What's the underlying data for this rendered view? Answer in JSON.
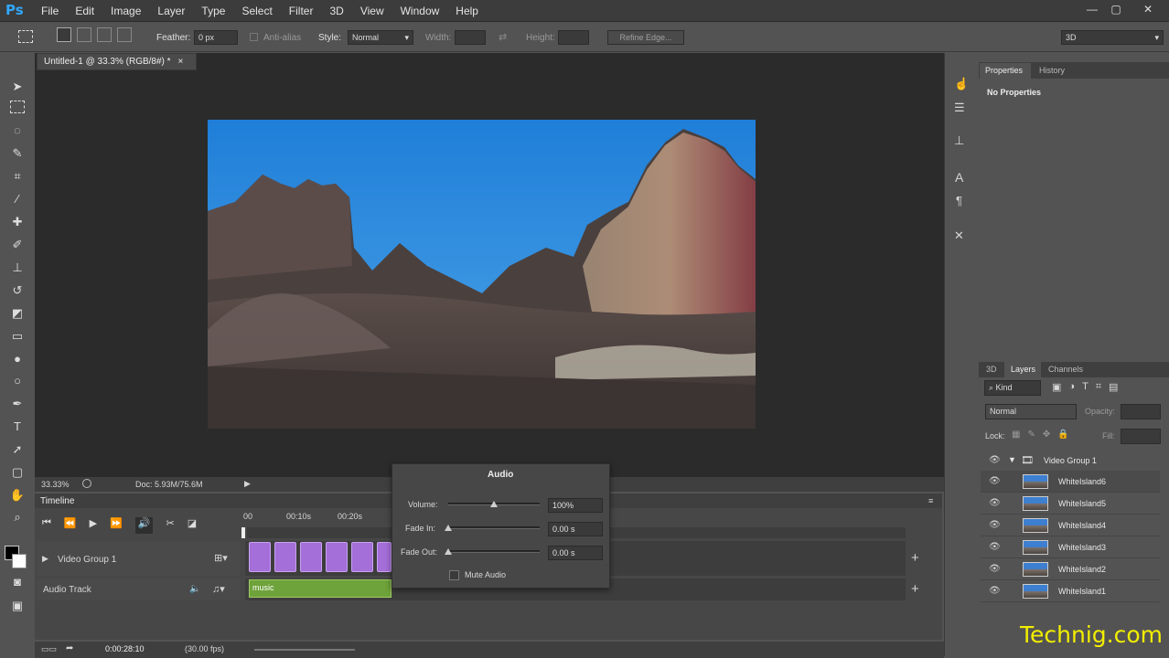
{
  "app": {
    "logo": "Ps",
    "workspace": "3D"
  },
  "menu": [
    "File",
    "Edit",
    "Image",
    "Layer",
    "Type",
    "Select",
    "Filter",
    "3D",
    "View",
    "Window",
    "Help"
  ],
  "window_controls": [
    "—",
    "▢",
    "✕"
  ],
  "options": {
    "feather_label": "Feather:",
    "feather_value": "0 px",
    "antialias_label": "Anti-alias",
    "style_label": "Style:",
    "style_value": "Normal",
    "width_label": "Width:",
    "height_label": "Height:",
    "refine_label": "Refine Edge..."
  },
  "document": {
    "tab_title": "Untitled-1 @ 33.3% (RGB/8#) *",
    "zoom": "33.33%",
    "doc_info": "Doc: 5.93M/75.6M"
  },
  "timeline": {
    "title": "Timeline",
    "ruler": [
      "00",
      "00:10s",
      "00:20s"
    ],
    "video_group": "Video Group 1",
    "audio_track": "Audio Track",
    "audio_clip": "music",
    "timecode": "0:00:28:10",
    "fps": "(30.00 fps)"
  },
  "audio_popup": {
    "title": "Audio",
    "volume_label": "Volume:",
    "volume_value": "100%",
    "fadein_label": "Fade In:",
    "fadein_value": "0.00 s",
    "fadeout_label": "Fade Out:",
    "fadeout_value": "0.00 s",
    "mute_label": "Mute Audio"
  },
  "properties": {
    "tabs": [
      "Properties",
      "History"
    ],
    "content": "No Properties"
  },
  "layers_panel": {
    "tabs": [
      "3D",
      "Layers",
      "Channels"
    ],
    "filter": "Kind",
    "blend_mode": "Normal",
    "opacity_label": "Opacity:",
    "lock_label": "Lock:",
    "fill_label": "Fill:",
    "group": "Video Group 1",
    "layers": [
      "WhiteIsland6",
      "WhiteIsland5",
      "WhiteIsland4",
      "WhiteIsland3",
      "WhiteIsland2",
      "WhiteIsland1"
    ]
  },
  "watermark": "Technig.com",
  "colors": {
    "accent": "#31a8ff",
    "video_clip": "#a46fd8",
    "audio_clip": "#6ea23a",
    "watermark": "#f2ee00"
  }
}
